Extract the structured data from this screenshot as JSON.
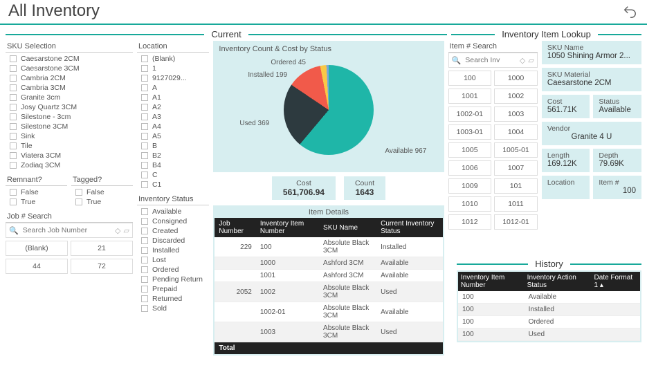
{
  "page_title": "All Inventory",
  "sections": {
    "current": "Current",
    "lookup": "Inventory Item Lookup",
    "history": "History"
  },
  "sku_selection": {
    "title": "SKU Selection",
    "items": [
      "Caesarstone 2CM",
      "Caesarstone 3CM",
      "Cambria 2CM",
      "Cambria 3CM",
      "Granite 3cm",
      "Josy Quartz 3CM",
      "Silestone - 3cm",
      "Silestone 3CM",
      "Sink",
      "Tile",
      "Viatera 3CM",
      "Zodiaq 3CM"
    ]
  },
  "location": {
    "title": "Location",
    "items": [
      "(Blank)",
      "1",
      "9127029...",
      "A",
      "A1",
      "A2",
      "A3",
      "A4",
      "A5",
      "B",
      "B2",
      "B4",
      "C",
      "C1"
    ]
  },
  "remnant": {
    "title": "Remnant?",
    "items": [
      "False",
      "True"
    ]
  },
  "tagged": {
    "title": "Tagged?",
    "items": [
      "False",
      "True"
    ]
  },
  "job_search": {
    "title": "Job # Search",
    "placeholder": "Search Job Number",
    "pills": [
      "(Blank)",
      "21",
      "44",
      "72"
    ]
  },
  "inv_status": {
    "title": "Inventory Status",
    "items": [
      "Available",
      "Consigned",
      "Created",
      "Discarded",
      "Installed",
      "Lost",
      "Ordered",
      "Pending Return",
      "Prepaid",
      "Returned",
      "Sold"
    ]
  },
  "chart_data": {
    "type": "pie",
    "title": "Inventory Count & Cost by Status",
    "series": [
      {
        "name": "Available",
        "value": 967,
        "color": "#1fb6a8"
      },
      {
        "name": "Used",
        "value": 369,
        "color": "#2d3a3f"
      },
      {
        "name": "Installed",
        "value": 199,
        "color": "#f15a4a"
      },
      {
        "name": "Ordered",
        "value": 45,
        "color": "#f9c846"
      }
    ],
    "labels": {
      "available": "Available 967",
      "used": "Used 369",
      "installed": "Installed 199",
      "ordered": "Ordered 45"
    }
  },
  "kpi": {
    "cost_label": "Cost",
    "cost": "561,706.94",
    "count_label": "Count",
    "count": "1643"
  },
  "details": {
    "title": "Item Details",
    "headers": [
      "Job Number",
      "Inventory Item Number",
      "SKU Name",
      "Current Inventory Status"
    ],
    "rows": [
      [
        "229",
        "100",
        "Absolute Black 3CM",
        "Installed"
      ],
      [
        "",
        "1000",
        "Ashford 3CM",
        "Available"
      ],
      [
        "",
        "1001",
        "Ashford 3CM",
        "Available"
      ],
      [
        "2052",
        "1002",
        "Absolute Black 3CM",
        "Used"
      ],
      [
        "",
        "1002-01",
        "Absolute Black 3CM",
        "Available"
      ],
      [
        "",
        "1003",
        "Absolute Black 3CM",
        "Used"
      ]
    ],
    "total": "Total"
  },
  "item_search": {
    "title": "Item # Search",
    "placeholder": "Search Inv",
    "pills": [
      "100",
      "1000",
      "1001",
      "1002",
      "1002-01",
      "1003",
      "1003-01",
      "1004",
      "1005",
      "1005-01",
      "1006",
      "1007",
      "1009",
      "101",
      "1010",
      "1011",
      "1012",
      "1012-01"
    ]
  },
  "lookup": {
    "sku_name_l": "SKU Name",
    "sku_name": "1050 Shining Armor 2...",
    "sku_mat_l": "SKU Material",
    "sku_mat": "Caesarstone 2CM",
    "cost_l": "Cost",
    "cost": "561.71K",
    "status_l": "Status",
    "status": "Available",
    "vendor_l": "Vendor",
    "vendor": "Granite 4 U",
    "length_l": "Length",
    "length": "169.12K",
    "depth_l": "Depth",
    "depth": "79.69K",
    "location_l": "Location",
    "location": "",
    "item_l": "Item #",
    "item": "100"
  },
  "history": {
    "headers": [
      "Inventory Item Number",
      "Inventory Action Status",
      "Date Format 1"
    ],
    "rows": [
      [
        "100",
        "Available",
        ""
      ],
      [
        "100",
        "Installed",
        ""
      ],
      [
        "100",
        "Ordered",
        ""
      ],
      [
        "100",
        "Used",
        ""
      ]
    ]
  }
}
